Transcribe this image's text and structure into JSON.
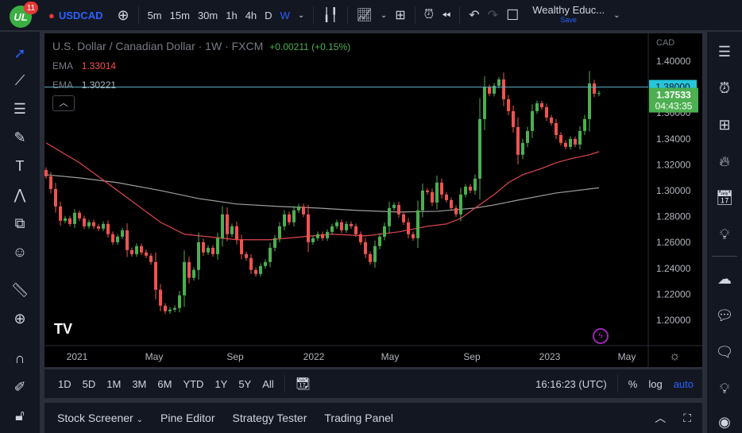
{
  "topbar": {
    "notifications": "11",
    "symbol": "USDCAD",
    "intervals": [
      "5m",
      "15m",
      "30m",
      "1h",
      "4h",
      "D",
      "W"
    ],
    "active_interval": "W",
    "layout_name": "Wealthy Educ...",
    "save_label": "Save"
  },
  "legend": {
    "title": "U.S. Dollar / Canadian Dollar · 1W · FXCM",
    "change": "+0.00211 (+0.15%)",
    "ema1_label": "EMA",
    "ema1_value": "1.33014",
    "ema2_label": "EMA",
    "ema2_value": "1.30221"
  },
  "colors": {
    "up": "#4caf50",
    "down": "#ef5350",
    "ema_fast": "#e0474f",
    "ema_slow": "#9e9e9e",
    "hline": "#5fb4c8",
    "accent": "#2962ff"
  },
  "chart_data": {
    "type": "candlestick",
    "currency": "CAD",
    "ylim": [
      1.19,
      1.42
    ],
    "y_ticks": [
      "1.40000",
      "1.38000",
      "1.36000",
      "1.34000",
      "1.32000",
      "1.30000",
      "1.28000",
      "1.26000",
      "1.24000",
      "1.22000",
      "1.20000"
    ],
    "x_ticks": [
      "2021",
      "May",
      "Sep",
      "2022",
      "May",
      "Sep",
      "2023",
      "May"
    ],
    "first_open": 1.316,
    "closes": [
      1.3111,
      1.3013,
      1.2878,
      1.2768,
      1.2786,
      1.2743,
      1.2829,
      1.2786,
      1.2725,
      1.2756,
      1.2725,
      1.2707,
      1.2743,
      1.2664,
      1.2602,
      1.2645,
      1.2694,
      1.2541,
      1.251,
      1.2572,
      1.2523,
      1.2498,
      1.2449,
      1.2235,
      1.2112,
      1.2069,
      1.2081,
      1.2094,
      1.2192,
      1.2449,
      1.2327,
      1.2388,
      1.2602,
      1.2523,
      1.2559,
      1.251,
      1.2633,
      1.2817,
      1.2664,
      1.2725,
      1.2621,
      1.251,
      1.248,
      1.2388,
      1.2357,
      1.2418,
      1.2449,
      1.2559,
      1.2633,
      1.2725,
      1.2817,
      1.2756,
      1.2848,
      1.2878,
      1.2817,
      1.2602,
      1.2633,
      1.2664,
      1.2633,
      1.2682,
      1.2725,
      1.2756,
      1.2694,
      1.2743,
      1.2725,
      1.2664,
      1.2602,
      1.251,
      1.2449,
      1.2572,
      1.2645,
      1.2725,
      1.2866,
      1.289,
      1.2817,
      1.2756,
      1.2664,
      1.2633,
      1.2848,
      1.3001,
      1.2989,
      1.2909,
      1.3062,
      1.297,
      1.2927,
      1.2866,
      1.2817,
      1.297,
      1.3031,
      1.3001,
      1.3093,
      1.3553,
      1.3798,
      1.3749,
      1.381,
      1.3859,
      1.3706,
      1.3614,
      1.3491,
      1.3277,
      1.3369,
      1.3461,
      1.3614,
      1.3675,
      1.3644,
      1.3565,
      1.3522,
      1.343,
      1.3369,
      1.3338,
      1.3399,
      1.3356,
      1.3461,
      1.3553,
      1.3828,
      1.3749,
      1.37533
    ],
    "ema_fast": {
      "index": [
        0,
        7,
        15,
        24,
        29,
        40,
        47,
        54,
        60,
        67,
        74,
        80,
        84,
        87,
        90,
        94,
        97,
        100,
        104,
        107,
        110,
        114,
        116
      ],
      "values": [
        1.3369,
        1.3216,
        1.3001,
        1.2756,
        1.2664,
        1.2621,
        1.2621,
        1.2645,
        1.2664,
        1.2651,
        1.2682,
        1.2725,
        1.2743,
        1.2786,
        1.2866,
        1.297,
        1.3062,
        1.3123,
        1.3172,
        1.3216,
        1.3246,
        1.3277,
        1.33014
      ]
    },
    "ema_slow": {
      "index": [
        0,
        7,
        15,
        24,
        32,
        40,
        49,
        57,
        65,
        74,
        82,
        90,
        94,
        99,
        107,
        116
      ],
      "values": [
        1.3123,
        1.3099,
        1.3062,
        1.3001,
        1.2939,
        1.2897,
        1.2878,
        1.2866,
        1.2848,
        1.2835,
        1.2841,
        1.2866,
        1.289,
        1.2927,
        1.2982,
        1.30221
      ]
    },
    "horizontal_line": {
      "value": 1.38,
      "label": "1.38000"
    },
    "last_price": {
      "label": "1.37533",
      "countdown": "04:43:35"
    }
  },
  "rangebar": {
    "ranges": [
      "1D",
      "5D",
      "1M",
      "3M",
      "6M",
      "YTD",
      "1Y",
      "5Y",
      "All"
    ],
    "time": "16:16:23 (UTC)",
    "percent": "%",
    "log": "log",
    "auto": "auto"
  },
  "bottom": {
    "tabs": [
      "Stock Screener",
      "Pine Editor",
      "Strategy Tester",
      "Trading Panel"
    ]
  }
}
